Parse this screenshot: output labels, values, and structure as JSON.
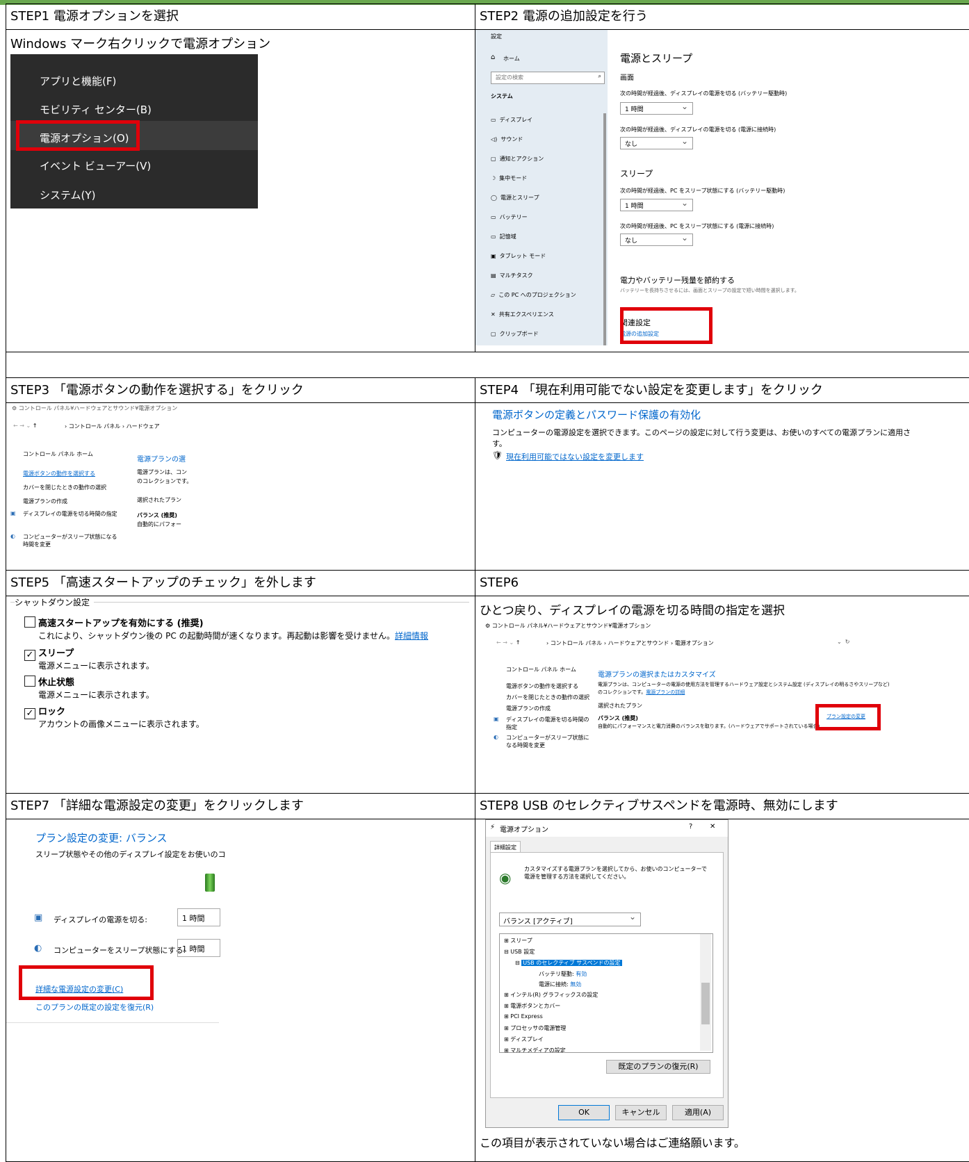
{
  "steps": {
    "s1": {
      "title": "STEP1 電源オプションを選択",
      "caption": "Windows マーク右クリックで電源オプション",
      "menu": [
        "アプリと機能(F)",
        "モビリティ センター(B)",
        "電源オプション(O)",
        "イベント ビューアー(V)",
        "システム(Y)"
      ]
    },
    "s2": {
      "title": "STEP2 電源の追加設定を行う",
      "app_title": "設定",
      "home": "ホーム",
      "search_placeholder": "設定の検索",
      "section": "システム",
      "nav": [
        "ディスプレイ",
        "サウンド",
        "通知とアクション",
        "集中モード",
        "電源とスリープ",
        "バッテリー",
        "記憶域",
        "タブレット モード",
        "マルチタスク",
        "この PC へのプロジェクション",
        "共有エクスペリエンス",
        "クリップボード"
      ],
      "heading": "電源とスリープ",
      "screen": "画面",
      "screen_batt": "次の時間が経過後、ディスプレイの電源を切る (バッテリー駆動時)",
      "screen_batt_val": "1 時間",
      "screen_ac": "次の時間が経過後、ディスプレイの電源を切る (電源に接続時)",
      "screen_ac_val": "なし",
      "sleep": "スリープ",
      "sleep_batt": "次の時間が経過後、PC をスリープ状態にする (バッテリー駆動時)",
      "sleep_batt_val": "1 時間",
      "sleep_ac": "次の時間が経過後、PC をスリープ状態にする (電源に接続時)",
      "sleep_ac_val": "なし",
      "save_title": "電力やバッテリー残量を節約する",
      "save_desc": "バッテリーを長持ちさせるには、画面とスリープの設定で短い時間を選択します。",
      "related": "関連設定",
      "related_link": "電源の追加設定"
    },
    "s3": {
      "title": "STEP3 「電源ボタンの動作を選択する」をクリック",
      "path": "コントロール パネル¥ハードウェアとサウンド¥電源オプション",
      "crumb": "› コントロール パネル › ハードウェア",
      "home": "コントロール パネル ホーム",
      "links": [
        "電源ボタンの動作を選択する",
        "カバーを閉じたときの動作の選択",
        "電源プランの作成",
        "ディスプレイの電源を切る時間の指定",
        "コンピューターがスリープ状態になる時間を変更"
      ],
      "plan_head": "電源プランの選",
      "plan_desc1": "電源プランは、コン",
      "plan_desc2": "のコレクションです。",
      "selected": "選択されたプラン",
      "plan": "バランス (推奨)",
      "plan_sub": "自動的にパフォー"
    },
    "s4": {
      "title": "STEP4 「現在利用可能でない設定を変更します」をクリック",
      "heading": "電源ボタンの定義とパスワード保護の有効化",
      "desc": "コンピューターの電源設定を選択できます。このページの設定に対して行う変更は、お使いのすべての電源プランに適用さ",
      "desc2": "す。",
      "link": "現在利用可能ではない設定を変更します"
    },
    "s5": {
      "title": "STEP5 「高速スタートアップのチェック」を外します",
      "group": "シャットダウン設定",
      "items": [
        {
          "label": "高速スタートアップを有効にする (推奨)",
          "desc": "これにより、シャットダウン後の PC の起動時間が速くなります。再起動は影響を受けません。",
          "link": "詳細情報",
          "mark": ""
        },
        {
          "label": "スリープ",
          "desc": "電源メニューに表示されます。",
          "mark": "✓"
        },
        {
          "label": "休止状態",
          "desc": "電源メニューに表示されます。",
          "mark": ""
        },
        {
          "label": "ロック",
          "desc": "アカウントの画像メニューに表示されます。",
          "mark": "✓"
        }
      ]
    },
    "s6": {
      "title": "STEP6",
      "caption": "ひとつ戻り、ディスプレイの電源を切る時間の指定を選択",
      "path": "コントロール パネル¥ハードウェアとサウンド¥電源オプション",
      "crumb": "› コントロール パネル › ハードウェアとサウンド › 電源オプション",
      "home": "コントロール パネル ホーム",
      "links": [
        "電源ボタンの動作を選択する",
        "カバーを閉じたときの動作の選択",
        "電源プランの作成",
        "ディスプレイの電源を切る時間の指定",
        "コンピューターがスリープ状態になる時間を変更"
      ],
      "plan_head": "電源プランの選択またはカスタマイズ",
      "plan_desc": "電源プランは、コンピューターの電源の使用方法を管理するハードウェア設定とシステム設定 (ディスプレイの明るさやスリープなど)",
      "plan_desc2": "のコレクションです。",
      "plan_more": "電源プランの詳細",
      "selected": "選択されたプラン",
      "plan": "バランス (推奨)",
      "plan_sub": "自動的にパフォーマンスと電力消費のバランスを取ります。(ハードウェアでサポートされている場合)",
      "change": "プラン設定の変更"
    },
    "s7": {
      "title": "STEP7 「詳細な電源設定の変更」をクリックします",
      "heading": "プラン設定の変更: バランス",
      "desc": "スリープ状態やその他のディスプレイ設定をお使いのコ",
      "display_label": "ディスプレイの電源を切る:",
      "display_val": "1 時間",
      "sleep_label": "コンピューターをスリープ状態にする:",
      "sleep_val": "1 時間",
      "adv_link": "詳細な電源設定の変更(C)",
      "restore_link": "このプランの既定の設定を復元(R)"
    },
    "s8": {
      "title": "STEP8 USB のセレクティブサスペンドを電源時、無効にします",
      "dlg_title": "電源オプション",
      "help": "?",
      "close": "✕",
      "tab": "詳細設定",
      "intro": "カスタマイズする電源プランを選択してから、お使いのコンピューターで電源を管理する方法を選択してください。",
      "plan": "バランス [アクティブ]",
      "tree": [
        {
          "t": "スリープ",
          "lvl": 0,
          "s": "⊞"
        },
        {
          "t": "USB 設定",
          "lvl": 0,
          "s": "⊟"
        },
        {
          "t": "USB のセレクティブ サスペンドの設定",
          "lvl": 1,
          "s": "⊟",
          "sel": true
        },
        {
          "t": "バッテリ駆動:",
          "v": "有効",
          "lvl": 2,
          "s": ""
        },
        {
          "t": "電源に接続:",
          "v": "無効",
          "lvl": 2,
          "s": ""
        },
        {
          "t": "インテル(R) グラフィックスの設定",
          "lvl": 0,
          "s": "⊞"
        },
        {
          "t": "電源ボタンとカバー",
          "lvl": 0,
          "s": "⊞"
        },
        {
          "t": "PCI Express",
          "lvl": 0,
          "s": "⊞"
        },
        {
          "t": "プロセッサの電源管理",
          "lvl": 0,
          "s": "⊞"
        },
        {
          "t": "ディスプレイ",
          "lvl": 0,
          "s": "⊞"
        },
        {
          "t": "マルチメディアの設定",
          "lvl": 0,
          "s": "⊞"
        }
      ],
      "restore": "既定のプランの復元(R)",
      "ok": "OK",
      "cancel": "キャンセル",
      "apply": "適用(A)",
      "note": "この項目が表示されていない場合はご連絡願います。"
    }
  }
}
